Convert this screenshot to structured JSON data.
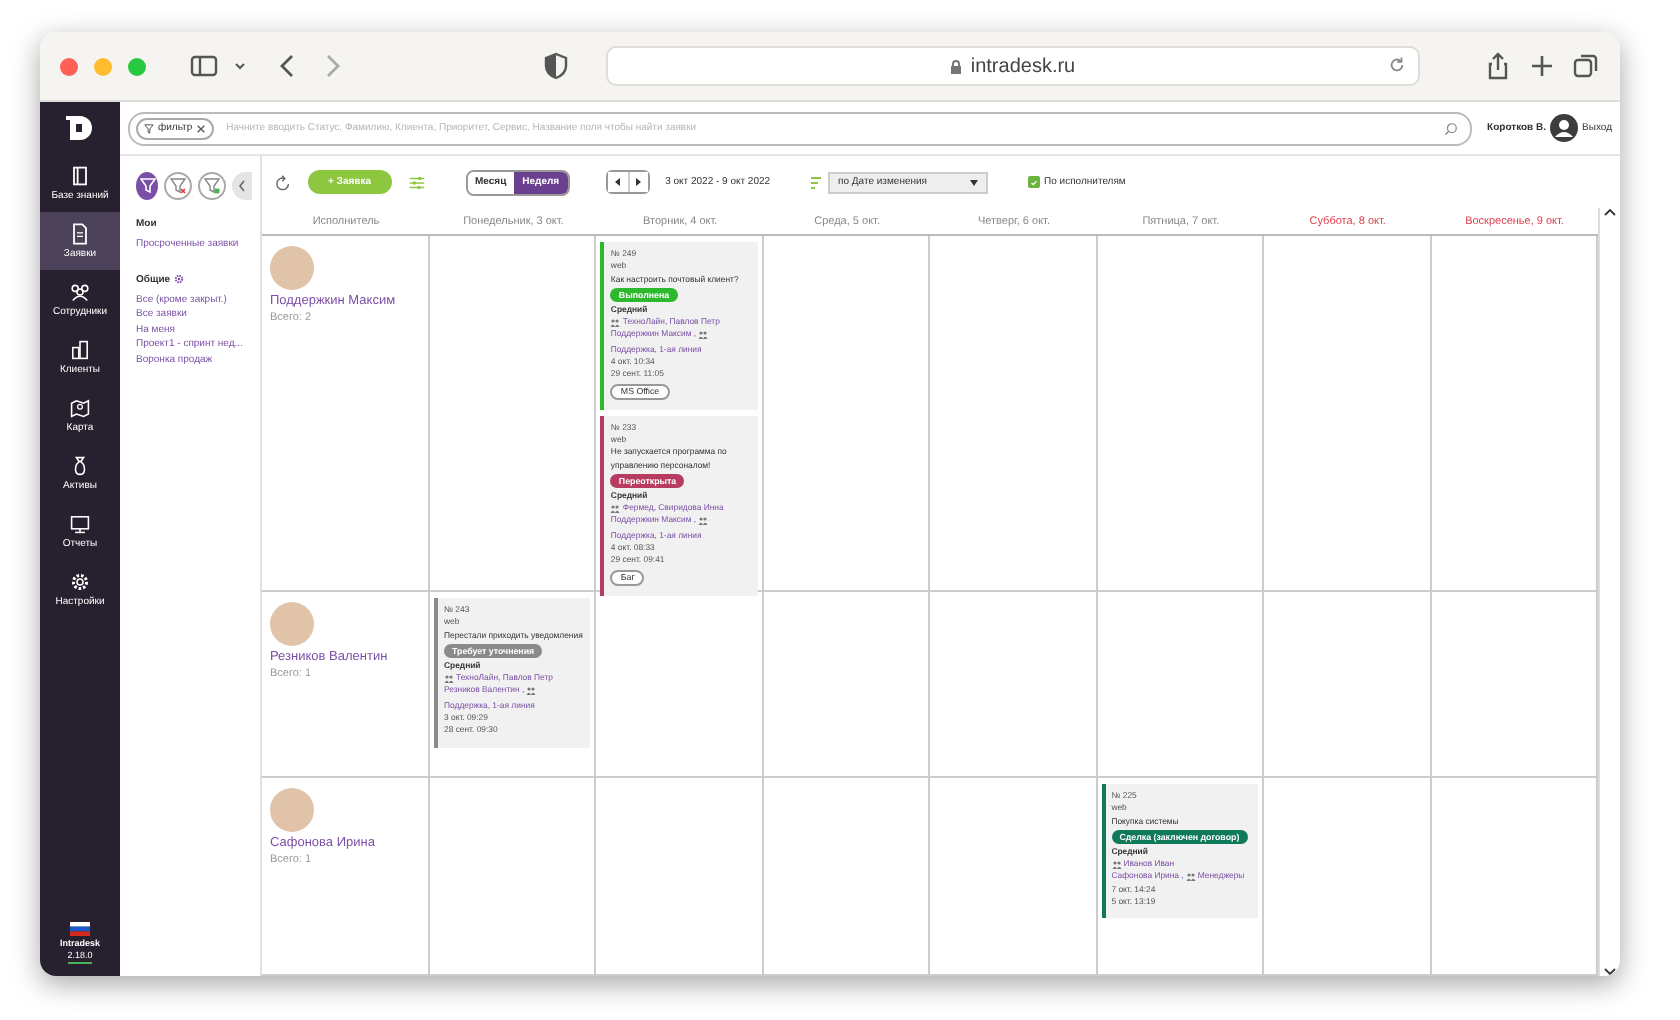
{
  "browser": {
    "address": "intradesk.ru"
  },
  "sidebar": {
    "items": [
      {
        "label": "Базе знаний",
        "selected": false
      },
      {
        "label": "Заявки",
        "selected": true
      },
      {
        "label": "Сотрудники",
        "selected": false
      },
      {
        "label": "Клиенты",
        "selected": false
      },
      {
        "label": "Карта",
        "selected": false
      },
      {
        "label": "Активы",
        "selected": false
      },
      {
        "label": "Отчеты",
        "selected": false
      },
      {
        "label": "Настройки",
        "selected": false
      }
    ],
    "product": "Intradesk",
    "version": "2.18.0"
  },
  "search": {
    "chip": "фильтр",
    "placeholder": "Начните вводить Статус, Фамилию, Клиента, Приоритет, Сервис, Название поля чтобы найти заявки",
    "user": "Коротков В.",
    "logout": "Выход"
  },
  "filters": {
    "sections": [
      {
        "title": "Мои",
        "has_settings": false,
        "items": [
          "Просроченные заявки"
        ]
      },
      {
        "title": "Общие",
        "has_settings": true,
        "items": [
          "Все (кроме закрыт.)",
          "Все заявки",
          "На меня",
          "Проект1 - спринт нед...",
          "Воронка продаж"
        ]
      }
    ]
  },
  "toolbar": {
    "new_button": "+ Заявка",
    "views": [
      {
        "label": "Месяц",
        "selected": false
      },
      {
        "label": "Неделя",
        "selected": true
      }
    ],
    "range": "3 окт 2022 - 9 окт 2022",
    "sort": "по Дате изменения",
    "by_executors": {
      "label": "По исполнителям",
      "checked": true
    }
  },
  "calendar": {
    "executor_heading": "Исполнитель",
    "days": [
      {
        "label": "Понедельник, 3 окт.",
        "weekend": false
      },
      {
        "label": "Вторник, 4 окт.",
        "weekend": false
      },
      {
        "label": "Среда, 5 окт.",
        "weekend": false
      },
      {
        "label": "Четверг, 6 окт.",
        "weekend": false
      },
      {
        "label": "Пятница, 7 окт.",
        "weekend": false
      },
      {
        "label": "Суббота, 8 окт.",
        "weekend": true
      },
      {
        "label": "Воскресенье, 9 окт.",
        "weekend": true
      }
    ],
    "rows": [
      {
        "name": "Поддержкин Максим",
        "total": "Всего: 2",
        "cells": [
          {},
          {
            "tickets": [
              {
                "number": "№ 249",
                "channel": "web",
                "subject": "Как настроить почтовый клиент?",
                "status": {
                  "label": "Выполнена",
                  "color": "#2db92d"
                },
                "priority": "Средний",
                "client": "ТехноЛайн, Павлов Петр",
                "assignee": "Поддержкин Максим ,",
                "group": "Поддержка, 1-ая линия",
                "created": "4 окт. 10:34",
                "updated": "29 сент. 11:05",
                "tag": "MS Office"
              },
              {
                "number": "№ 233",
                "channel": "web",
                "subject": "Не запускается программа по управлению персоналом!",
                "status": {
                  "label": "Переоткрыта",
                  "color": "#b83b62"
                },
                "priority": "Средний",
                "client": "Фермед, Свиридова Инна",
                "assignee": "Поддержкин Максим ,",
                "group": "Поддержка, 1-ая линия",
                "created": "4 окт. 08:33",
                "updated": "29 сент. 09:41",
                "tag": "Баг"
              }
            ]
          },
          {},
          {},
          {},
          {},
          {}
        ]
      },
      {
        "name": "Резников Валентин",
        "total": "Всего: 1",
        "cells": [
          {
            "tickets": [
              {
                "number": "№ 243",
                "channel": "web",
                "subject": "Перестали приходить уведомления",
                "status": {
                  "label": "Требует уточнения",
                  "color": "#8a8a8a"
                },
                "priority": "Средний",
                "client": "ТехноЛайн, Павлов Петр",
                "assignee": "Резников Валентин ,",
                "group": "Поддержка, 1-ая линия",
                "created": "3 окт. 09:29",
                "updated": "28 сент. 09:30"
              }
            ]
          },
          {},
          {},
          {},
          {},
          {},
          {}
        ]
      },
      {
        "name": "Сафонова Ирина",
        "total": "Всего: 1",
        "cells": [
          {},
          {},
          {},
          {},
          {
            "tickets": [
              {
                "number": "№ 225",
                "channel": "web",
                "subject": "Покупка системы",
                "status": {
                  "label": "Сделка (заключен договор)",
                  "color": "#0f7a5a"
                },
                "priority": "Средний",
                "client": "Иванов Иван",
                "assignee": "Сафонова Ирина ,",
                "group": "Менеджеры",
                "created": "7 окт. 14:24",
                "updated": "5 окт. 13:19"
              }
            ]
          },
          {},
          {}
        ]
      }
    ]
  }
}
